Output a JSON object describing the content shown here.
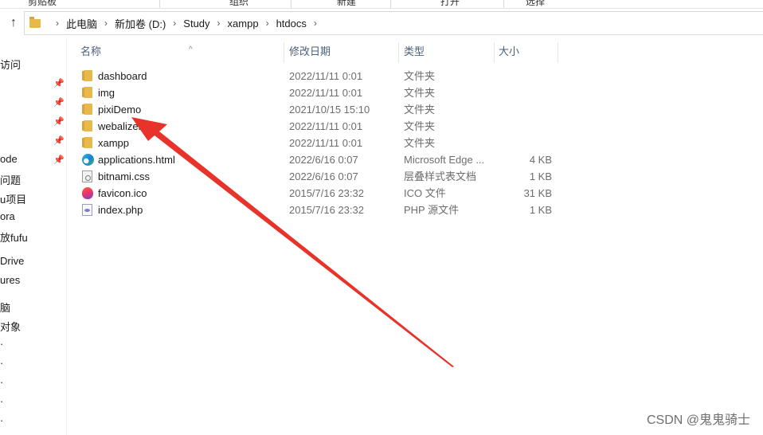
{
  "ribbon": {
    "items": [
      {
        "label": "剪贴板"
      },
      {
        "label": "组织"
      },
      {
        "label": "新建"
      },
      {
        "label": "打开"
      },
      {
        "label": "选择"
      }
    ]
  },
  "address": {
    "breadcrumbs": [
      "此电脑",
      "新加卷 (D:)",
      "Study",
      "xampp",
      "htdocs"
    ]
  },
  "nav_pane": {
    "items": [
      {
        "label": "访问",
        "pinned": false
      },
      {
        "label": "",
        "pinned": true
      },
      {
        "label": "",
        "pinned": true
      },
      {
        "label": "",
        "pinned": true
      },
      {
        "label": "",
        "pinned": true
      },
      {
        "label": "ode",
        "pinned": true
      },
      {
        "label": "问题",
        "pinned": false
      },
      {
        "label": "u项目",
        "pinned": false
      },
      {
        "label": "ora",
        "pinned": false
      },
      {
        "label": "放fufu",
        "pinned": false
      },
      {
        "label": "Drive",
        "pinned": false
      },
      {
        "label": "ures",
        "pinned": false
      },
      {
        "label": "脑",
        "pinned": false
      },
      {
        "label": "对象",
        "pinned": false
      }
    ]
  },
  "columns": {
    "name": "名称",
    "date": "修改日期",
    "type": "类型",
    "size": "大小"
  },
  "files": [
    {
      "name": "dashboard",
      "date": "2022/11/11 0:01",
      "type": "文件夹",
      "size": "",
      "icon": "folder-icon"
    },
    {
      "name": "img",
      "date": "2022/11/11 0:01",
      "type": "文件夹",
      "size": "",
      "icon": "folder-icon"
    },
    {
      "name": "pixiDemo",
      "date": "2021/10/15 15:10",
      "type": "文件夹",
      "size": "",
      "icon": "folder-icon"
    },
    {
      "name": "webalizer",
      "date": "2022/11/11 0:01",
      "type": "文件夹",
      "size": "",
      "icon": "folder-icon"
    },
    {
      "name": "xampp",
      "date": "2022/11/11 0:01",
      "type": "文件夹",
      "size": "",
      "icon": "folder-icon"
    },
    {
      "name": "applications.html",
      "date": "2022/6/16 0:07",
      "type": "Microsoft Edge ...",
      "size": "4 KB",
      "icon": "edge-html-icon"
    },
    {
      "name": "bitnami.css",
      "date": "2022/6/16 0:07",
      "type": "层叠样式表文档",
      "size": "1 KB",
      "icon": "css-file-icon"
    },
    {
      "name": "favicon.ico",
      "date": "2015/7/16 23:32",
      "type": "ICO 文件",
      "size": "31 KB",
      "icon": "ico-file-icon"
    },
    {
      "name": "index.php",
      "date": "2015/7/16 23:32",
      "type": "PHP 源文件",
      "size": "1 KB",
      "icon": "php-file-icon"
    }
  ],
  "annotation": {
    "arrow_color": "#e8332b"
  },
  "watermark": "CSDN @鬼鬼骑士"
}
